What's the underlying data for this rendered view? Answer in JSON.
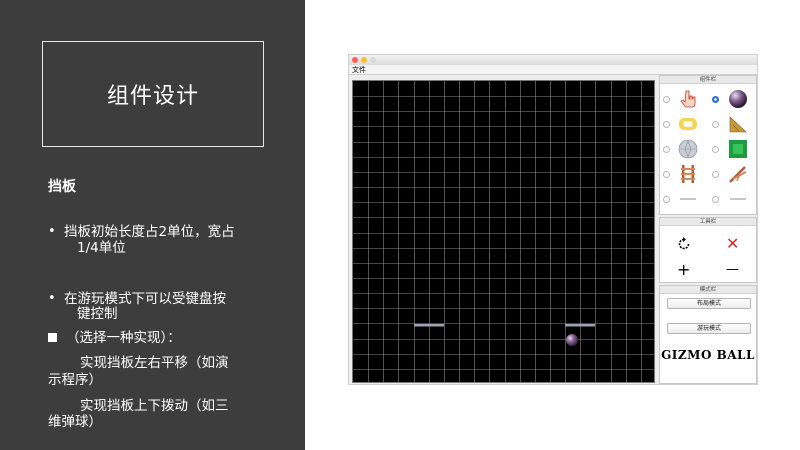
{
  "slide": {
    "title": "组件设计",
    "section_heading": "挡板",
    "bullets": [
      {
        "line1": "挡板初始长度占2单位，宽占",
        "line2": "1/4单位"
      },
      {
        "line1": "在游玩模式下可以受键盘按",
        "line2": "键控制"
      }
    ],
    "square_bullet": "（选择一种实现）：",
    "options": [
      {
        "line1": "实现挡板左右平移（如演",
        "line2": "示程序）"
      },
      {
        "line1": "实现挡板上下拨动（如三",
        "line2": "维弹球）"
      }
    ],
    "colors": {
      "background": "#3d3d3d",
      "text": "#ffffff"
    }
  },
  "app": {
    "menu": {
      "file_label": "文件"
    },
    "components_panel": {
      "title": "组件栏",
      "items": [
        {
          "icon": "hand-pointer-icon",
          "selected": false
        },
        {
          "icon": "ball-icon",
          "selected": true
        },
        {
          "icon": "absorber-ring-icon",
          "selected": false
        },
        {
          "icon": "triangle-icon",
          "selected": false
        },
        {
          "icon": "diamond-circle-icon",
          "selected": false
        },
        {
          "icon": "green-square-icon",
          "selected": false
        },
        {
          "icon": "track-icon",
          "selected": false
        },
        {
          "icon": "curved-track-icon",
          "selected": false
        },
        {
          "icon": "left-paddle-icon",
          "selected": false
        },
        {
          "icon": "right-paddle-icon",
          "selected": false
        }
      ]
    },
    "tools_panel": {
      "title": "工具栏",
      "rotate_icon": "rotate-icon",
      "delete_label": "✕",
      "zoom_in_label": "+",
      "zoom_out_label": "—"
    },
    "mode_panel": {
      "title": "模式栏",
      "layout_mode_label": "布局模式",
      "play_mode_label": "游玩模式",
      "logo_text": "GIZMO BALL"
    }
  }
}
